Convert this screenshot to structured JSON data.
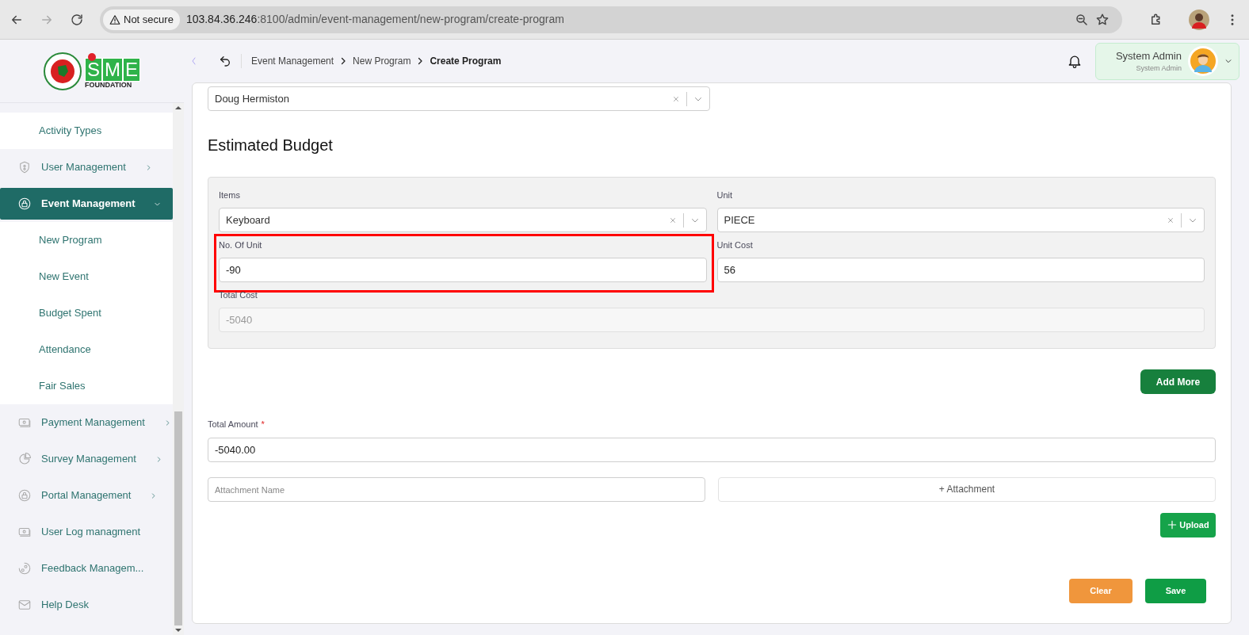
{
  "browser": {
    "security": "Not secure",
    "url_host": "103.84.36.246",
    "url_rest": ":8100/admin/event-management/new-program/create-program"
  },
  "logo": {
    "letters": [
      "S",
      "M",
      "E"
    ],
    "tagline": "FOUNDATION"
  },
  "sidebar": {
    "items": [
      {
        "kind": "sub",
        "label": "Activity Types",
        "selected": false
      },
      {
        "kind": "group",
        "label": "User Management",
        "selected": false,
        "expanded": false,
        "submenu": true
      },
      {
        "kind": "group",
        "label": "Event Management",
        "selected": true,
        "expanded": true,
        "submenu": true,
        "children": [
          {
            "kind": "sub",
            "label": "New Program",
            "selected": false
          },
          {
            "kind": "sub",
            "label": "New Event",
            "selected": false
          },
          {
            "kind": "sub",
            "label": "Budget Spent",
            "selected": false
          },
          {
            "kind": "sub",
            "label": "Attendance",
            "selected": false
          },
          {
            "kind": "sub",
            "label": "Fair Sales",
            "selected": false
          }
        ]
      },
      {
        "kind": "group",
        "label": "Payment Management",
        "selected": false,
        "expanded": false,
        "submenu": true
      },
      {
        "kind": "group",
        "label": "Survey Management",
        "selected": false,
        "expanded": false,
        "submenu": true
      },
      {
        "kind": "group",
        "label": "Portal Management",
        "selected": false,
        "expanded": false,
        "submenu": true
      },
      {
        "kind": "group",
        "label": "User Log managment",
        "selected": false,
        "submenu": false
      },
      {
        "kind": "group",
        "label": "Feedback Managem...",
        "selected": false,
        "submenu": false
      },
      {
        "kind": "group",
        "label": "Help Desk",
        "selected": false,
        "submenu": false
      }
    ]
  },
  "header": {
    "breadcrumb": [
      "Event Management",
      "New Program",
      "Create Program"
    ],
    "user": {
      "name": "System Admin",
      "role": "System Admin"
    }
  },
  "form": {
    "owner_select": {
      "value": "Doug Hermiston"
    },
    "section_title": "Estimated Budget",
    "budget": {
      "items": {
        "label": "Items",
        "value": "Keyboard"
      },
      "unit": {
        "label": "Unit",
        "value": "PIECE"
      },
      "no_of_unit": {
        "label": "No. Of Unit",
        "value": "-90",
        "highlighted": true
      },
      "unit_cost": {
        "label": "Unit Cost",
        "value": "56"
      },
      "total_cost": {
        "label": "Total Cost",
        "value": "-5040",
        "disabled": true
      }
    },
    "add_more": "Add More",
    "total_amount": {
      "label": "Total Amount",
      "required_mark": "*",
      "value": "-5040.00"
    },
    "attachment_name": {
      "placeholder": "Attachment Name"
    },
    "attachment_button": "+ Attachment",
    "upload": "Upload",
    "clear": "Clear",
    "save": "Save"
  }
}
